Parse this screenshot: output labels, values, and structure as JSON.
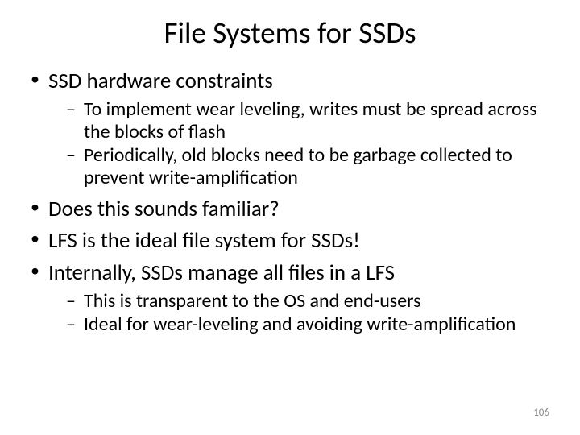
{
  "title": "File Systems for SSDs",
  "bullets": {
    "b1": "SSD hardware constraints",
    "b1_sub1": "To implement wear leveling, writes must be spread across the blocks of flash",
    "b1_sub2": "Periodically, old blocks need to be garbage collected to prevent write-amplification",
    "b2": "Does this sounds familiar?",
    "b3": "LFS is the ideal file system for SSDs!",
    "b4": "Internally, SSDs manage all files in a LFS",
    "b4_sub1": "This is transparent to the OS and end-users",
    "b4_sub2": "Ideal for wear-leveling and avoiding write-amplification"
  },
  "page_number": "106"
}
